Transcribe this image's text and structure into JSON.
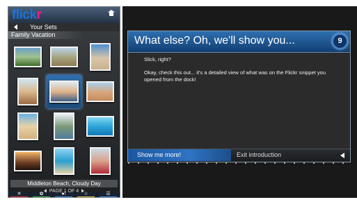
{
  "app": {
    "logo_part1": "flick",
    "logo_part2": "r"
  },
  "nav": {
    "back_label": "Your Sets",
    "set_title": "Family Vacation"
  },
  "gallery": {
    "selected_index": 4,
    "caption": "Middleton Beach, Cloudy Day",
    "page_label": "PAGE 1 OF 4"
  },
  "toolbar": {
    "items": [
      "✕",
      "✿",
      "●!",
      "☆",
      "☰"
    ],
    "colors": [
      "#e63b3b",
      "#3fbf4f",
      "#3a8ee6",
      "#e6c23b",
      "#3a8ee6"
    ]
  },
  "dialog": {
    "title": "What else? Oh, we'll show you...",
    "step_number": "9",
    "line1": "Slick, right?",
    "line2": "Okay, check this out... it's a detailed view of what was on the Flickr snippet you opened from the dock!",
    "primary_button": "Show me more!",
    "secondary_button": "Exit introduction"
  },
  "colors": {
    "flickr_blue": "#1b73d6",
    "flickr_pink": "#ff1a86",
    "dialog_header": "#2e6fb0"
  }
}
